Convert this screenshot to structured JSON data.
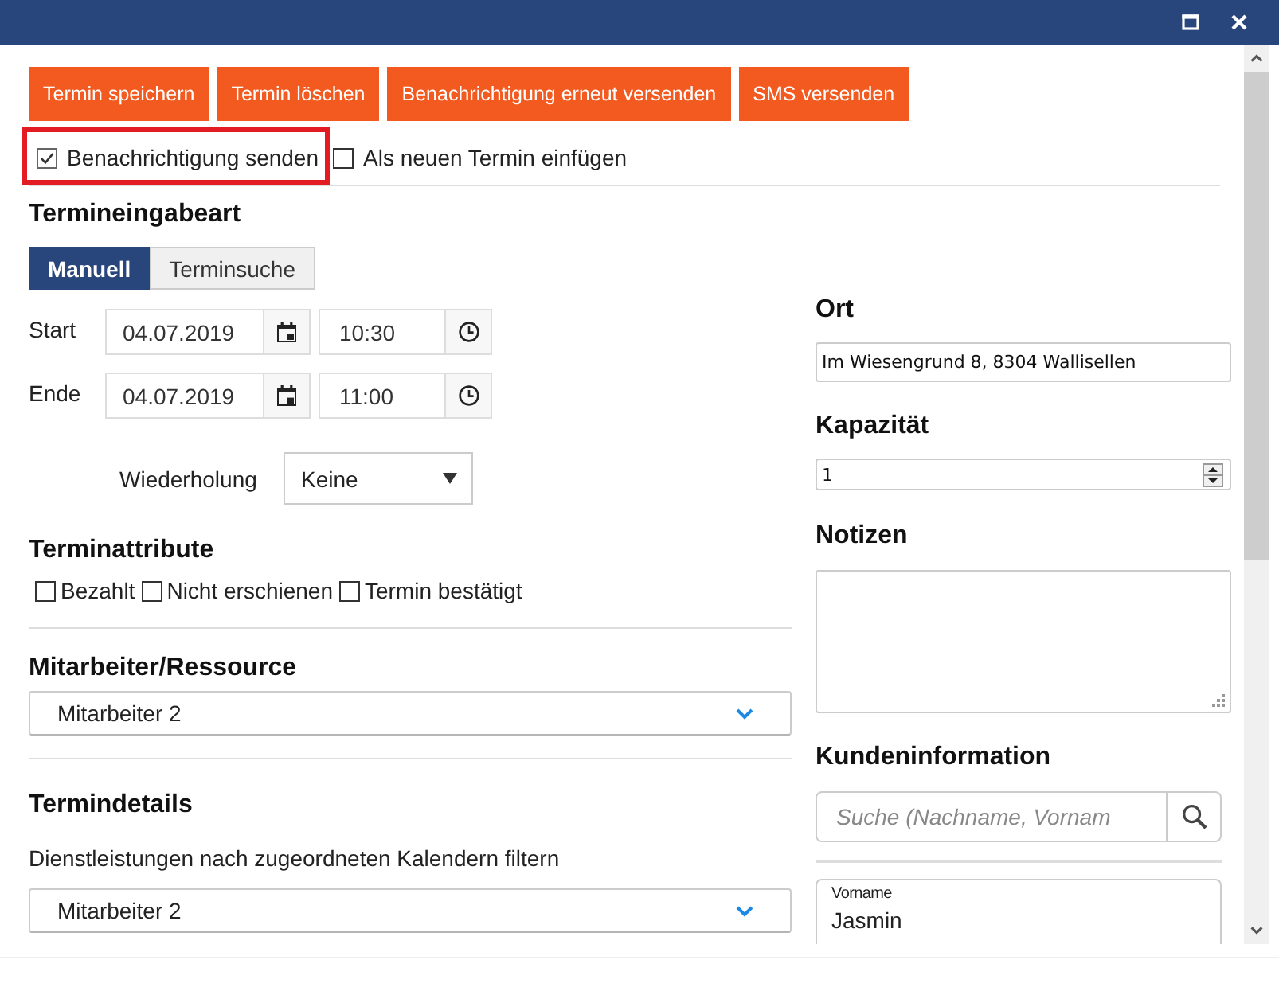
{
  "toolbar": {
    "buttons": [
      "Termin speichern",
      "Termin löschen",
      "Benachrichtigung erneut versenden",
      "SMS versenden"
    ]
  },
  "options": [
    {
      "label": "Benachrichtigung senden",
      "checked": true,
      "highlighted": true
    },
    {
      "label": "Als neuen Termin einfügen",
      "checked": false,
      "highlighted": false
    }
  ],
  "entry_mode": {
    "heading": "Termineingabeart",
    "tabs": [
      {
        "label": "Manuell",
        "selected": true
      },
      {
        "label": "Terminsuche",
        "selected": false
      }
    ]
  },
  "schedule": [
    {
      "label": "Start",
      "date": "04.07.2019",
      "time": "10:30"
    },
    {
      "label": "Ende",
      "date": "04.07.2019",
      "time": "11:00"
    }
  ],
  "recurrence": {
    "label": "Wiederholung",
    "value": "Keine"
  },
  "attributes": {
    "heading": "Terminattribute",
    "items": [
      {
        "label": "Bezahlt",
        "checked": false
      },
      {
        "label": "Nicht erschienen",
        "checked": false
      },
      {
        "label": "Termin bestätigt",
        "checked": false
      }
    ]
  },
  "resource": {
    "heading": "Mitarbeiter/Ressource",
    "value": "Mitarbeiter 2"
  },
  "details": {
    "heading": "Termindetails",
    "filter_label": "Dienstleistungen nach zugeordneten Kalendern filtern",
    "value": "Mitarbeiter 2"
  },
  "location": {
    "heading": "Ort",
    "value": "Im Wiesengrund 8, 8304 Wallisellen"
  },
  "capacity": {
    "heading": "Kapazität",
    "value": "1"
  },
  "notes": {
    "heading": "Notizen"
  },
  "customer": {
    "heading": "Kundeninformation",
    "search": {
      "placeholder": "Suche (Nachname, Vornam"
    },
    "fields": [
      {
        "label": "Vorname",
        "value": "Jasmin"
      }
    ]
  }
}
